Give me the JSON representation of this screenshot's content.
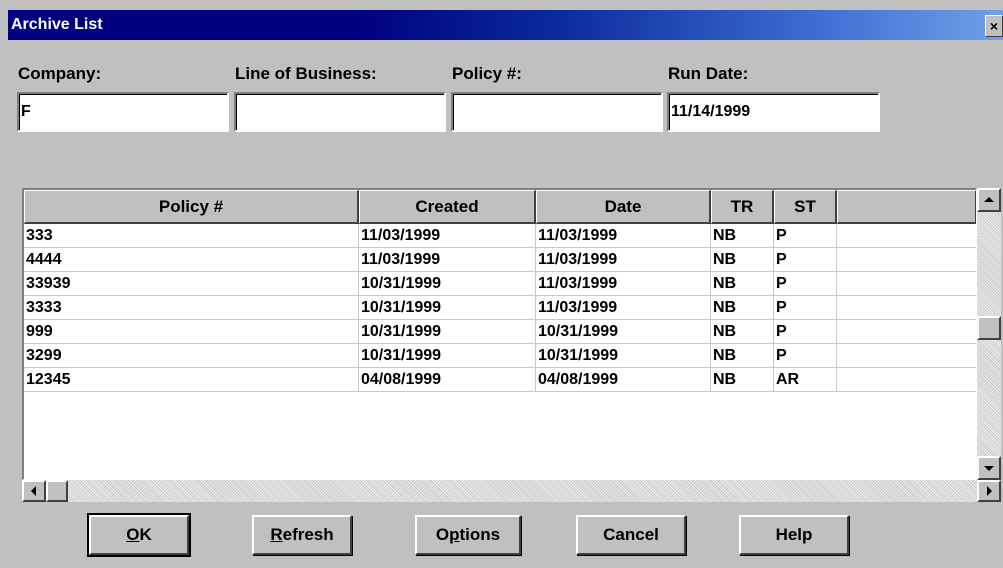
{
  "window": {
    "title": "Archive List",
    "close_glyph": "×"
  },
  "filters": {
    "company": {
      "label": "Company:",
      "value": "F"
    },
    "line_of_business": {
      "label": "Line of Business:",
      "value": ""
    },
    "policy": {
      "label": "Policy #:",
      "value": ""
    },
    "run_date": {
      "label": "Run Date:",
      "value": "11/14/1999"
    }
  },
  "grid": {
    "columns": [
      "Policy #",
      "Created",
      "Date",
      "TR",
      "ST",
      ""
    ],
    "rows": [
      [
        "333",
        "11/03/1999",
        "11/03/1999",
        "NB",
        "P"
      ],
      [
        "4444",
        "11/03/1999",
        "11/03/1999",
        "NB",
        "P"
      ],
      [
        "33939",
        "10/31/1999",
        "11/03/1999",
        "NB",
        "P"
      ],
      [
        "3333",
        "10/31/1999",
        "11/03/1999",
        "NB",
        "P"
      ],
      [
        "999",
        "10/31/1999",
        "10/31/1999",
        "NB",
        "P"
      ],
      [
        "3299",
        "10/31/1999",
        "10/31/1999",
        "NB",
        "P"
      ],
      [
        "12345",
        "04/08/1999",
        "04/08/1999",
        "NB",
        "AR"
      ]
    ]
  },
  "scroll_icons": {
    "up": "up-arrow-icon",
    "down": "down-arrow-icon",
    "left": "left-arrow-icon",
    "right": "right-arrow-icon"
  },
  "buttons": {
    "ok": {
      "mnemonic": "O",
      "rest": "K"
    },
    "refresh": {
      "mnemonic": "R",
      "rest": "efresh"
    },
    "options": {
      "pre": "O",
      "mnemonic": "p",
      "rest": "tions"
    },
    "cancel": {
      "label": "Cancel"
    },
    "help": {
      "label": "Help"
    }
  }
}
